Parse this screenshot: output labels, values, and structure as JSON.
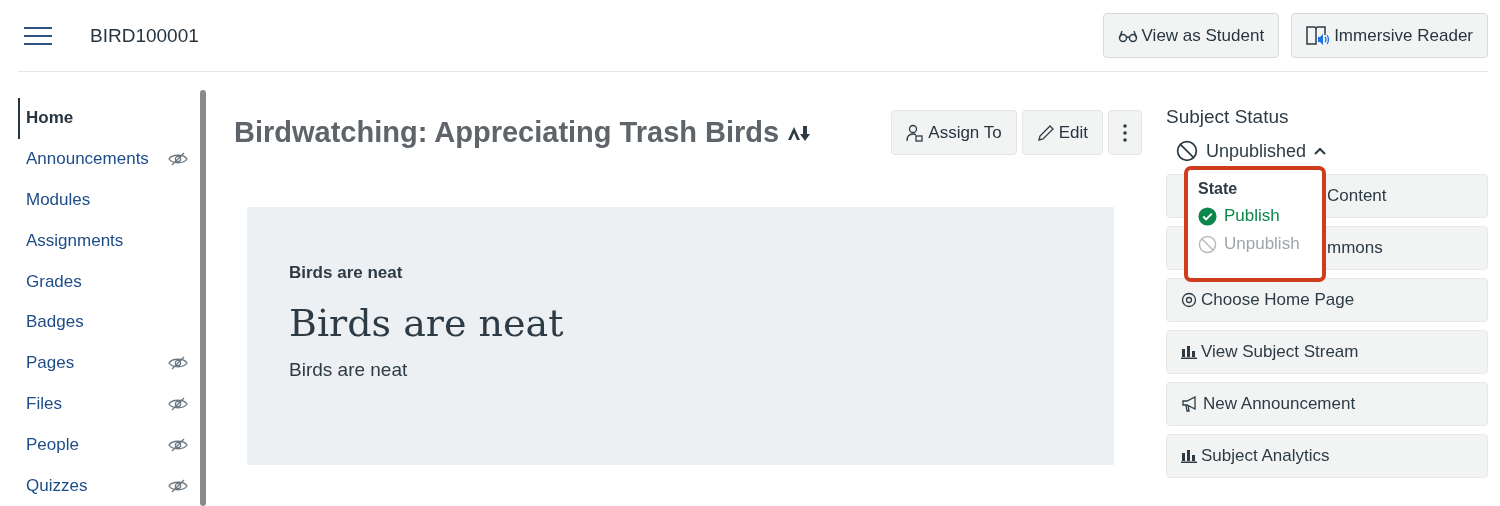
{
  "header": {
    "course": "BIRD100001",
    "buttons": [
      {
        "label": "View as Student",
        "kind": "glasses"
      },
      {
        "label": "Immersive Reader",
        "kind": "reader"
      }
    ]
  },
  "sidebar": {
    "items": [
      {
        "label": "Home",
        "selected": true,
        "hidden": false
      },
      {
        "label": "Announcements",
        "selected": false,
        "hidden": true
      },
      {
        "label": "Modules",
        "selected": false,
        "hidden": false
      },
      {
        "label": "Assignments",
        "selected": false,
        "hidden": false
      },
      {
        "label": "Grades",
        "selected": false,
        "hidden": false
      },
      {
        "label": "Badges",
        "selected": false,
        "hidden": false
      },
      {
        "label": "Pages",
        "selected": false,
        "hidden": true
      },
      {
        "label": "Files",
        "selected": false,
        "hidden": true
      },
      {
        "label": "People",
        "selected": false,
        "hidden": true
      },
      {
        "label": "Quizzes",
        "selected": false,
        "hidden": true
      }
    ]
  },
  "page": {
    "title": "Birdwatching: Appreciating Trash Birds",
    "actions": [
      {
        "label": "Assign To",
        "kind": "assign"
      },
      {
        "label": "Edit",
        "kind": "edit"
      },
      {
        "kind": "more"
      }
    ],
    "content": {
      "small_heading": "Birds are neat",
      "heading": "Birds are neat",
      "paragraph": "Birds are neat"
    }
  },
  "status": {
    "title": "Subject Status",
    "state": "Unpublished",
    "expanded": true,
    "menu": {
      "title": "State",
      "options": [
        {
          "label": "Publish",
          "selected": true
        },
        {
          "label": "Unpublish",
          "selected": false
        }
      ]
    },
    "buttons": [
      {
        "label": "Content",
        "kind": "none"
      },
      {
        "label": "mmons",
        "kind": "none"
      },
      {
        "label": "Choose Home Page",
        "kind": "home"
      },
      {
        "label": "View Subject Stream",
        "kind": "chart"
      },
      {
        "label": "New Announcement",
        "kind": "megaphone"
      },
      {
        "label": "Subject Analytics",
        "kind": "chart"
      }
    ]
  }
}
